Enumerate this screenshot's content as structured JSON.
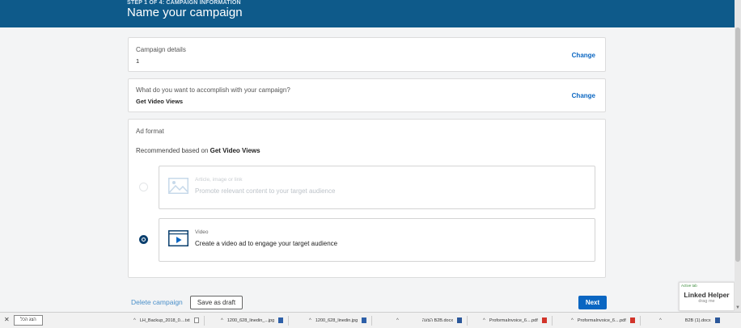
{
  "header": {
    "step": "STEP 1 OF 4: CAMPAIGN INFORMATION",
    "title": "Name your campaign"
  },
  "campaign_details": {
    "label": "Campaign details",
    "value": "1",
    "change_label": "Change"
  },
  "objective": {
    "label": "What do you want to accomplish with your campaign?",
    "value": "Get Video Views",
    "change_label": "Change"
  },
  "ad_format": {
    "label": "Ad format",
    "recommended_prefix": "Recommended based on",
    "recommended_value": "Get Video Views",
    "options": [
      {
        "title": "Article, image or link",
        "description": "Promote relevant content to your target audience",
        "selected": false,
        "icon": "image-icon"
      },
      {
        "title": "Video",
        "description": "Create a video ad to engage your target audience",
        "selected": true,
        "icon": "video-icon"
      }
    ]
  },
  "footer": {
    "delete_label": "Delete campaign",
    "draft_label": "Save as draft",
    "next_label": "Next"
  },
  "linked_helper": {
    "tag": "Active tab",
    "name": "Linked Helper",
    "sub": "drag me"
  },
  "downloads": {
    "show_all": "הצג הכל",
    "items": [
      {
        "name": "LH_Backup_2018_0....txt"
      },
      {
        "name": "1200_628_linedin_...jpg"
      },
      {
        "name": "1200_628_linedin.jpg"
      },
      {
        "name": "הצעה B2B.docx"
      },
      {
        "name": "ProformaInvoice_6....pdf"
      },
      {
        "name": "ProformaInvoice_6....pdf"
      },
      {
        "name": "B2B (1).docx"
      }
    ]
  },
  "colors": {
    "header_bg": "#0e5a8a",
    "accent": "#0a66c2",
    "radio_selected": "#0a3f6e"
  }
}
